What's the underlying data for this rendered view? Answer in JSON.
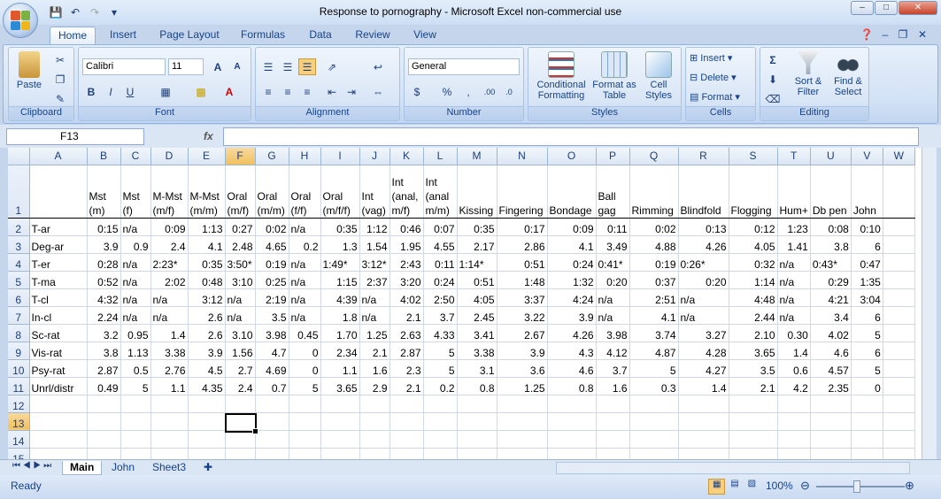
{
  "window": {
    "title": "Response to pornography - Microsoft Excel non-commercial use"
  },
  "tabs": [
    "Home",
    "Insert",
    "Page Layout",
    "Formulas",
    "Data",
    "Review",
    "View"
  ],
  "ribbon": {
    "clipboard": {
      "label": "Clipboard",
      "paste": "Paste"
    },
    "font": {
      "label": "Font",
      "name": "Calibri",
      "size": "11"
    },
    "alignment": {
      "label": "Alignment"
    },
    "number": {
      "label": "Number",
      "format": "General"
    },
    "styles": {
      "label": "Styles",
      "conditional": "Conditional Formatting",
      "format_table": "Format as Table",
      "cell_styles": "Cell Styles"
    },
    "cells": {
      "label": "Cells",
      "insert": "Insert",
      "delete": "Delete",
      "format": "Format"
    },
    "editing": {
      "label": "Editing",
      "sort": "Sort & Filter",
      "find": "Find & Select"
    }
  },
  "formula_bar": {
    "name_box": "F13",
    "fx": "fx",
    "value": ""
  },
  "columns": [
    "A",
    "B",
    "C",
    "D",
    "E",
    "F",
    "G",
    "H",
    "I",
    "J",
    "K",
    "L",
    "M",
    "N",
    "O",
    "P",
    "Q",
    "R",
    "S",
    "T",
    "U",
    "V",
    "W"
  ],
  "selected_column": "F",
  "selected_row": "13",
  "header_row": [
    "",
    "Mst (m)",
    "Mst (f)",
    "M-Mst (m/f)",
    "M-Mst (m/m)",
    "Oral (m/f)",
    "Oral (m/m)",
    "Oral (f/f)",
    "Oral (m/f/f)",
    "Int (vag)",
    "Int (anal, m/f)",
    "Int (anal m/m)",
    "Kissing",
    "Fingering",
    "Bondage",
    "Ball gag",
    "Rimming",
    "Blindfold",
    "Flogging",
    "Hum+",
    "Db pen",
    "John",
    ""
  ],
  "rows": [
    [
      "T-ar",
      "0:15",
      "n/a",
      "0:09",
      "1:13",
      "0:27",
      "0:02",
      "n/a",
      "0:35",
      "1:12",
      "0:46",
      "0:07",
      "0:35",
      "0:17",
      "0:09",
      "0:11",
      "0:02",
      "0:13",
      "0:12",
      "1:23",
      "0:08",
      "0:10",
      ""
    ],
    [
      "Deg-ar",
      "3.9",
      "0.9",
      "2.4",
      "4.1",
      "2.48",
      "4.65",
      "0.2",
      "1.3",
      "1.54",
      "1.95",
      "4.55",
      "2.17",
      "2.86",
      "4.1",
      "3.49",
      "4.88",
      "4.26",
      "4.05",
      "1.41",
      "3.8",
      "6",
      ""
    ],
    [
      "T-er",
      "0:28",
      "n/a",
      "2:23*",
      "0:35",
      "3:50*",
      "0:19",
      "n/a",
      "1:49*",
      "3:12*",
      "2:43",
      "0:11",
      "1:14*",
      "0:51",
      "0:24",
      "0:41*",
      "0:19",
      "0:26*",
      "0:32",
      "n/a",
      "0:43*",
      "0:47",
      ""
    ],
    [
      "T-ma",
      "0:52",
      "n/a",
      "2:02",
      "0:48",
      "3:10",
      "0:25",
      "n/a",
      "1:15",
      "2:37",
      "3:20",
      "0:24",
      "0:51",
      "1:48",
      "1:32",
      "0:20",
      "0:37",
      "0:20",
      "1:14",
      "n/a",
      "0:29",
      "1:35",
      ""
    ],
    [
      "T-cl",
      "4:32",
      "n/a",
      "n/a",
      "3:12",
      "n/a",
      "2:19",
      "n/a",
      "4:39",
      "n/a",
      "4:02",
      "2:50",
      "4:05",
      "3:37",
      "4:24",
      "n/a",
      "2:51",
      "n/a",
      "4:48",
      "n/a",
      "4:21",
      "3:04",
      ""
    ],
    [
      "In-cl",
      "2.24",
      "n/a",
      "n/a",
      "2.6",
      "n/a",
      "3.5",
      "n/a",
      "1.8",
      "n/a",
      "2.1",
      "3.7",
      "2.45",
      "3.22",
      "3.9",
      "n/a",
      "4.1",
      "n/a",
      "2.44",
      "n/a",
      "3.4",
      "6",
      ""
    ],
    [
      "Sc-rat",
      "3.2",
      "0.95",
      "1.4",
      "2.6",
      "3.10",
      "3.98",
      "0.45",
      "1.70",
      "1.25",
      "2.63",
      "4.33",
      "3.41",
      "2.67",
      "4.26",
      "3.98",
      "3.74",
      "3.27",
      "2.10",
      "0.30",
      "4.02",
      "5",
      ""
    ],
    [
      "Vis-rat",
      "3.8",
      "1.13",
      "3.38",
      "3.9",
      "1.56",
      "4.7",
      "0",
      "2.34",
      "2.1",
      "2.87",
      "5",
      "3.38",
      "3.9",
      "4.3",
      "4.12",
      "4.87",
      "4.28",
      "3.65",
      "1.4",
      "4.6",
      "6",
      ""
    ],
    [
      "Psy-rat",
      "2.87",
      "0.5",
      "2.76",
      "4.5",
      "2.7",
      "4.69",
      "0",
      "1.1",
      "1.6",
      "2.3",
      "5",
      "3.1",
      "3.6",
      "4.6",
      "3.7",
      "5",
      "4.27",
      "3.5",
      "0.6",
      "4.57",
      "5",
      ""
    ],
    [
      "Unrl/distr",
      "0.49",
      "5",
      "1.1",
      "4.35",
      "2.4",
      "0.7",
      "5",
      "3.65",
      "2.9",
      "2.1",
      "0.2",
      "0.8",
      "1.25",
      "0.8",
      "1.6",
      "0.3",
      "1.4",
      "2.1",
      "4.2",
      "2.35",
      "0",
      ""
    ]
  ],
  "sheet_tabs": [
    "Main",
    "John",
    "Sheet3"
  ],
  "status": {
    "ready": "Ready",
    "zoom": "100%"
  }
}
